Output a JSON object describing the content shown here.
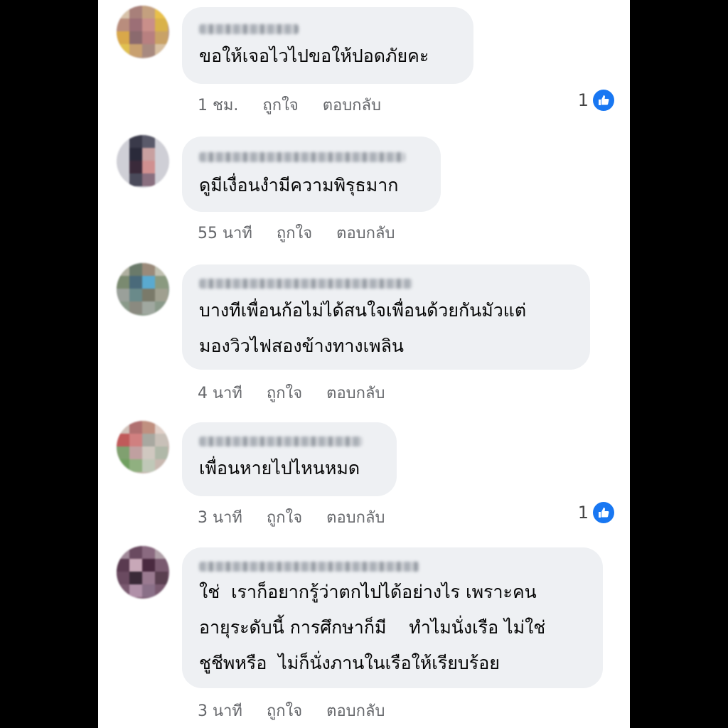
{
  "colors": {
    "bubble": "#eef0f3",
    "meta_text": "#65676b",
    "like_blue": "#1877f2"
  },
  "comments": [
    {
      "text": "ขอให้เจอไวไปขอให้ปอดภัยคะ",
      "time": "1 ชม.",
      "like_label": "ถูกใจ",
      "reply_label": "ตอบกลับ",
      "reaction_count": "1"
    },
    {
      "text": "ดูมีเงื่อนงำมีความพิรุธมาก",
      "time": "55 นาที",
      "like_label": "ถูกใจ",
      "reply_label": "ตอบกลับ"
    },
    {
      "text": "บางทีเพื่อนก้อไม่ได้สนใจเพื่อนด้วยกันมัวแต่\nมองวิวไฟสองข้างทางเพลิน",
      "time": "4 นาที",
      "like_label": "ถูกใจ",
      "reply_label": "ตอบกลับ"
    },
    {
      "text": "เพื่อนหายไปไหนหมด",
      "time": "3 นาที",
      "like_label": "ถูกใจ",
      "reply_label": "ตอบกลับ",
      "reaction_count": "1"
    },
    {
      "text": "ใช่  เราก็อยากรู้ว่าตกไปได้อย่างไร เพราะคน\nอายุระดับนี้ การศึกษาก็มี    ทำไมนั่งเรือ ไม่ใช่\nชูชีพหรือ  ไม่ก็นั่งภานในเรือให้เรียบร้อย",
      "time": "3 นาที",
      "like_label": "ถูกใจ",
      "reply_label": "ตอบกลับ"
    }
  ]
}
